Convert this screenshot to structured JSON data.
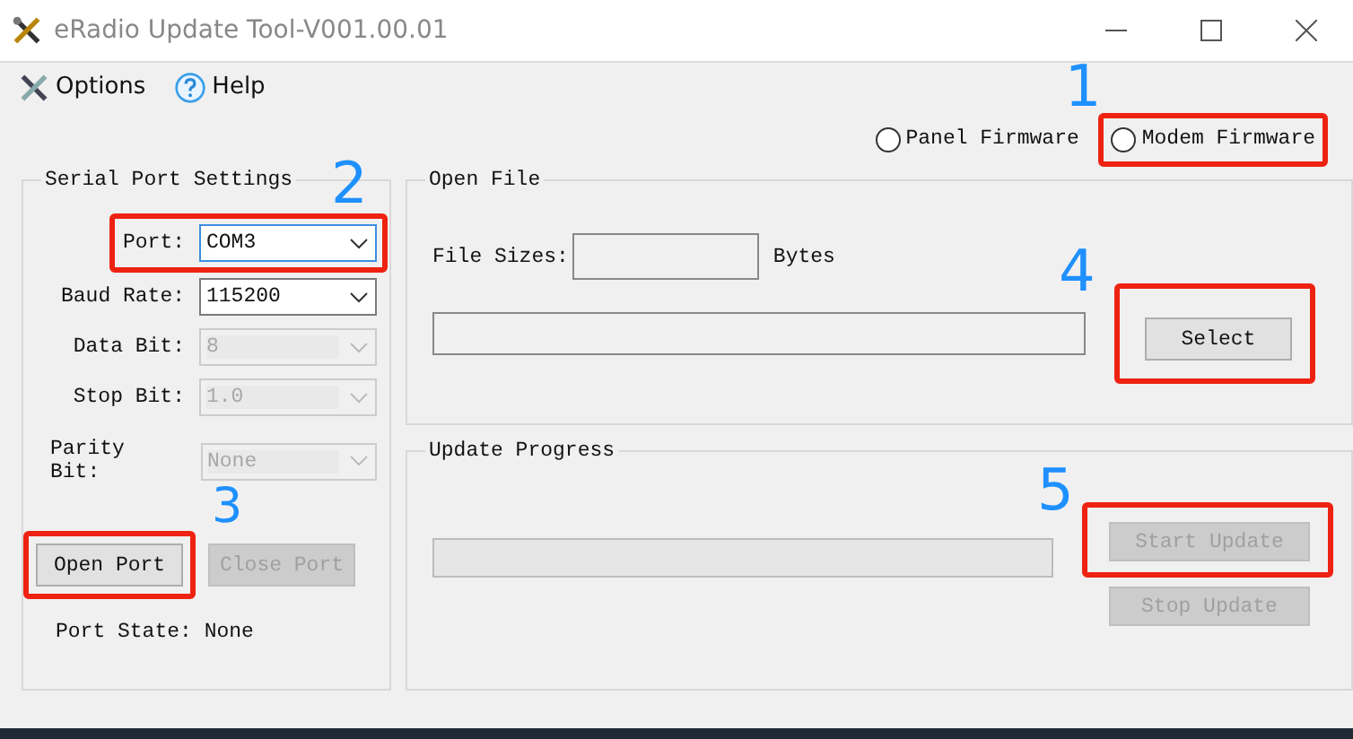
{
  "window": {
    "title": "eRadio Update Tool-V001.00.01"
  },
  "menu": [
    {
      "label": "Options",
      "kind": "options"
    },
    {
      "label": "Help",
      "kind": "help"
    }
  ],
  "firmware": [
    {
      "label": "Panel Firmware",
      "selected": false
    },
    {
      "label": "Modem Firmware",
      "selected": false,
      "callout": "1"
    }
  ],
  "serial": {
    "title": "Serial Port Settings",
    "fields": [
      {
        "label": "Port:",
        "value": "COM3",
        "disabled": false,
        "focused": true,
        "callout": "2"
      },
      {
        "label": "Baud Rate:",
        "value": "115200",
        "disabled": false,
        "focused": false
      },
      {
        "label": "Data Bit:",
        "value": "8",
        "disabled": true,
        "focused": false
      },
      {
        "label": "Stop Bit:",
        "value": "1.0",
        "disabled": true,
        "focused": false
      },
      {
        "label": "Parity Bit:",
        "value": "None",
        "disabled": true,
        "focused": false
      }
    ],
    "buttons": [
      {
        "label": "Open Port",
        "disabled": false,
        "callout": "3"
      },
      {
        "label": "Close Port",
        "disabled": true
      }
    ],
    "state": "Port State: None"
  },
  "open_file": {
    "title": "Open File",
    "size_label": "File Sizes:",
    "size_unit": "Bytes",
    "button": {
      "label": "Select",
      "disabled": false,
      "callout": "4"
    }
  },
  "update": {
    "title": "Update Progress",
    "level": 0,
    "buttons": [
      {
        "label": "Start Update",
        "disabled": true,
        "callout": "5"
      },
      {
        "label": "Stop Update",
        "disabled": true
      }
    ]
  }
}
